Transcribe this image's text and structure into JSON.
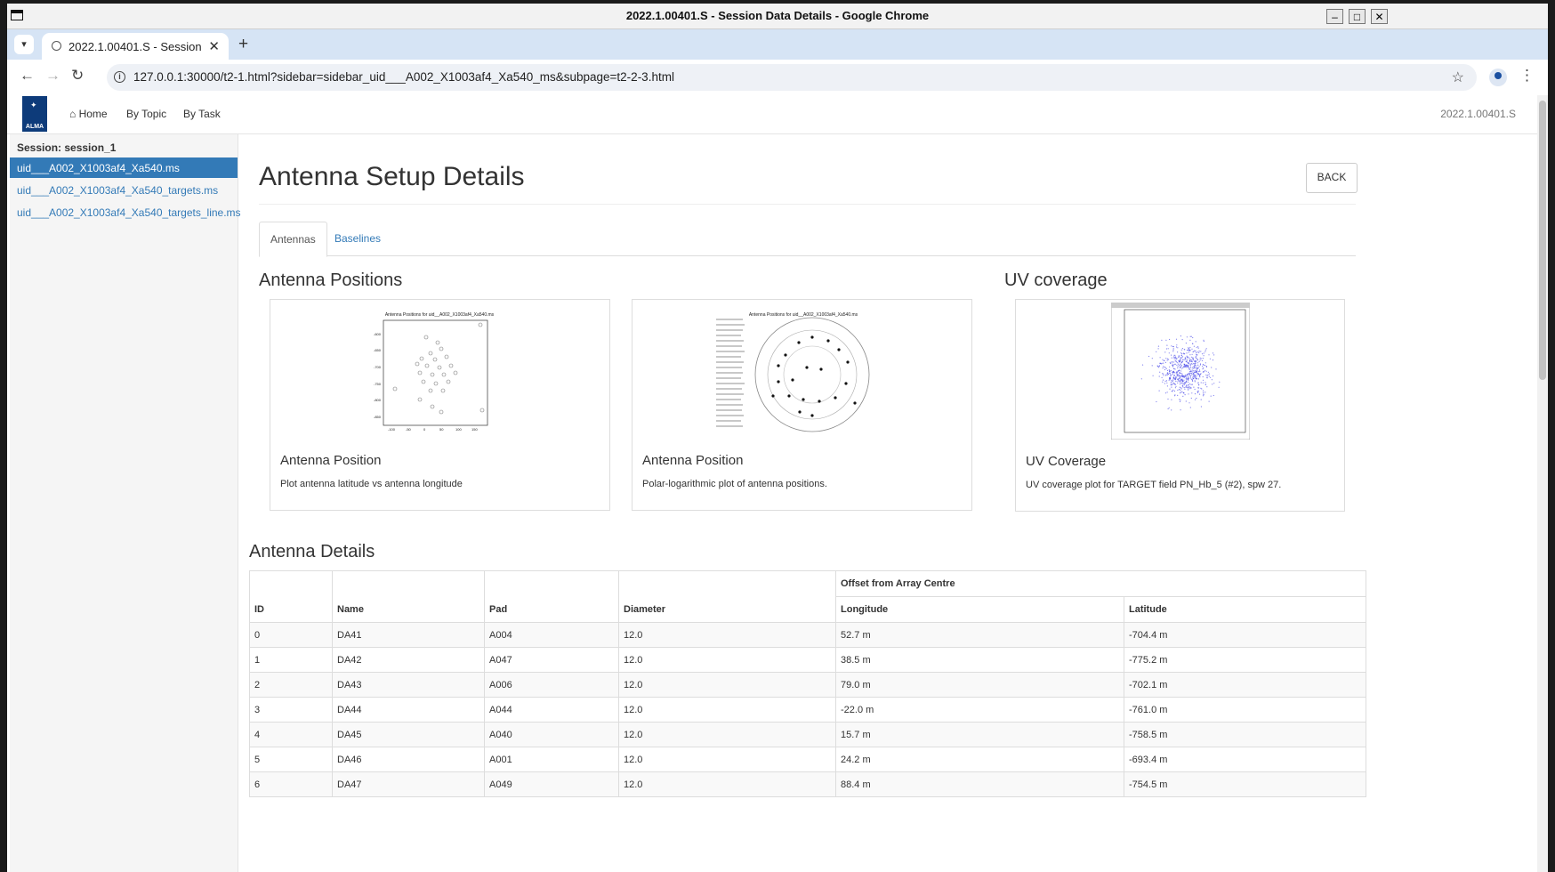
{
  "window": {
    "title": "2022.1.00401.S - Session Data Details - Google Chrome"
  },
  "browser": {
    "tab_title": "2022.1.00401.S - Session",
    "url": "127.0.0.1:30000/t2-1.html?sidebar=sidebar_uid___A002_X1003af4_Xa540_ms&subpage=t2-2-3.html"
  },
  "navbar": {
    "logo_text": "ALMA",
    "home": "Home",
    "by_topic": "By Topic",
    "by_task": "By Task",
    "version": "2022.1.00401.S"
  },
  "sidebar": {
    "session": "Session: session_1",
    "items": [
      {
        "label": "uid___A002_X1003af4_Xa540.ms"
      },
      {
        "label": "uid___A002_X1003af4_Xa540_targets.ms"
      },
      {
        "label": "uid___A002_X1003af4_Xa540_targets_line.ms"
      }
    ]
  },
  "main": {
    "title": "Antenna Setup Details",
    "back": "BACK",
    "tabs": [
      {
        "label": "Antennas"
      },
      {
        "label": "Baselines"
      }
    ],
    "antenna_positions_heading": "Antenna Positions",
    "uv_heading": "UV coverage",
    "cards": [
      {
        "title": "Antenna Position",
        "text": "Plot antenna latitude vs antenna longitude",
        "plot_title": "Antenna Positions for uid__A002_X1003af4_Xa540.ms"
      },
      {
        "title": "Antenna Position",
        "text": "Polar-logarithmic plot of antenna positions.",
        "plot_title": "Antenna Positions for uid__A002_X1003af4_Xa540.ms"
      },
      {
        "title": "UV Coverage",
        "text": "UV coverage plot for TARGET field PN_Hb_5 (#2), spw 27."
      }
    ],
    "details_heading": "Antenna Details"
  },
  "table": {
    "group_header": "Offset from Array Centre",
    "headers": [
      "ID",
      "Name",
      "Pad",
      "Diameter",
      "Longitude",
      "Latitude"
    ],
    "rows": [
      [
        "0",
        "DA41",
        "A004",
        "12.0",
        "52.7 m",
        "-704.4 m"
      ],
      [
        "1",
        "DA42",
        "A047",
        "12.0",
        "38.5 m",
        "-775.2 m"
      ],
      [
        "2",
        "DA43",
        "A006",
        "12.0",
        "79.0 m",
        "-702.1 m"
      ],
      [
        "3",
        "DA44",
        "A044",
        "12.0",
        "-22.0 m",
        "-761.0 m"
      ],
      [
        "4",
        "DA45",
        "A040",
        "12.0",
        "15.7 m",
        "-758.5 m"
      ],
      [
        "5",
        "DA46",
        "A001",
        "12.0",
        "24.2 m",
        "-693.4 m"
      ],
      [
        "6",
        "DA47",
        "A049",
        "12.0",
        "88.4 m",
        "-754.5 m"
      ]
    ]
  },
  "colors": {
    "link": "#337ab7",
    "active_bg": "#337ab7",
    "tabstrip": "#d6e4f5",
    "uv_points": "#4a4ae8"
  },
  "icons": {
    "home": "home-icon",
    "star": "star-icon",
    "globe": "globe-icon",
    "profile": "profile-icon"
  }
}
